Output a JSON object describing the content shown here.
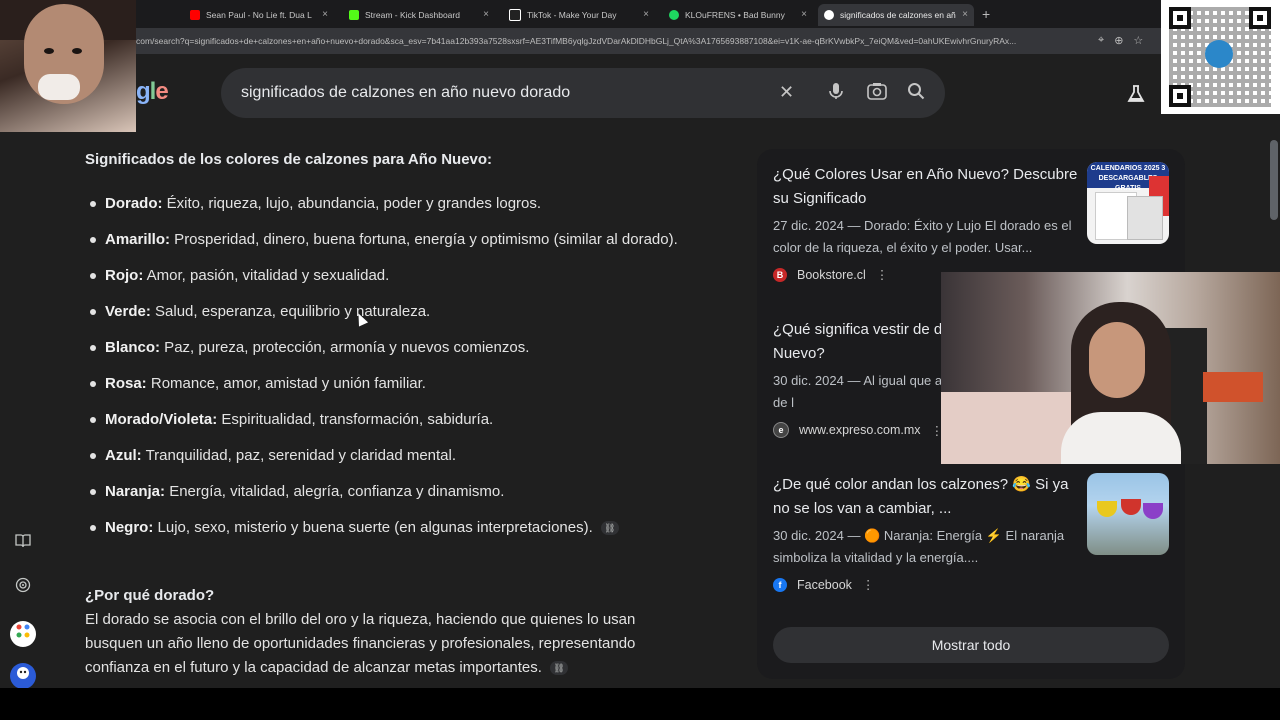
{
  "tabs": [
    {
      "label": "Sean Paul - No Lie ft. Dua L",
      "favicon_color": "#ff0000",
      "active": false
    },
    {
      "label": "Stream - Kick Dashboard",
      "favicon_color": "#53fc18",
      "active": false
    },
    {
      "label": "TikTok - Make Your Day",
      "favicon_color": "#ffffff",
      "active": false
    },
    {
      "label": "KLOuFRENS • Bad Bunny",
      "favicon_color": "#1ed760",
      "active": false
    },
    {
      "label": "significados de calzones en añ",
      "favicon_color": "#ffffff",
      "active": true
    }
  ],
  "tab_close": "×",
  "new_tab": "+",
  "url": "com/search?q=significados+de+calzones+en+año+nuevo+dorado&sca_esv=7b41aa12b393a7528sxsrf=AE3TifMB6yqlgJzdVDarAkDlDHbGLj_QtA%3A1765693887108&ei=v1K-ae-qBrKVwbkPx_7eiQM&ved=0ahUKEwivhrGnuryRAx...",
  "google": {
    "logo_text": "gle",
    "search_query": "significados de calzones en año nuevo dorado"
  },
  "main": {
    "heading": "Significados de los colores de calzones para Año Nuevo:",
    "items": [
      {
        "term": "Dorado:",
        "text": " Éxito, riqueza, lujo, abundancia, poder y grandes logros."
      },
      {
        "term": "Amarillo:",
        "text": " Prosperidad, dinero, buena fortuna, energía y optimismo (similar al dorado)."
      },
      {
        "term": "Rojo:",
        "text": " Amor, pasión, vitalidad y sexualidad."
      },
      {
        "term": "Verde:",
        "text": " Salud, esperanza, equilibrio y naturaleza."
      },
      {
        "term": "Blanco:",
        "text": " Paz, pureza, protección, armonía y nuevos comienzos."
      },
      {
        "term": "Rosa:",
        "text": " Romance, amor, amistad y unión familiar."
      },
      {
        "term": "Morado/Violeta:",
        "text": " Espiritualidad, transformación, sabiduría."
      },
      {
        "term": "Azul:",
        "text": " Tranquilidad, paz, serenidad y claridad mental."
      },
      {
        "term": "Naranja:",
        "text": " Energía, vitalidad, alegría, confianza y dinamismo."
      },
      {
        "term": "Negro:",
        "text": " Lujo, sexo, misterio y buena suerte (en algunas interpretaciones)."
      }
    ],
    "why_heading": "¿Por qué dorado?",
    "why_text": "El dorado se asocia con el brillo del oro y la riqueza, haciendo que quienes lo usan busquen un año lleno de oportunidades financieras y profesionales, representando confianza en el futuro y la capacidad de alcanzar metas importantes."
  },
  "sources": [
    {
      "title": "¿Qué Colores Usar en Año Nuevo? Descubre su Significado",
      "snippet": "27 dic. 2024 — Dorado: Éxito y Lujo El dorado es el color de la riqueza, el éxito y el poder. Usar...",
      "site": "Bookstore.cl",
      "site_icon_letter": "B",
      "site_icon_color": "#c62828",
      "thumb_text": "CALENDARIOS 2025 3 DESCARGABLES GRATIS"
    },
    {
      "title": "¿Qué significa vestir de dorado en Año Nuevo?",
      "snippet": "30 dic. 2024 — Al igual que amarillo, el rojo es uno de l",
      "site": "www.expreso.com.mx",
      "site_icon_letter": "e",
      "site_icon_color": "#444444"
    },
    {
      "title": "¿De qué color andan los calzones? 😂 Si ya no se los van a cambiar, ...",
      "snippet": "30 dic. 2024 — 🟠 Naranja: Energía ⚡ El naranja simboliza la vitalidad y la energía....",
      "site": "Facebook",
      "site_icon_letter": "f",
      "site_icon_color": "#1877f2"
    }
  ],
  "show_all": "Mostrar todo",
  "icons": {
    "more": "⋮",
    "clear": "✕",
    "mic": "🎙",
    "lens": "⌾",
    "search": "⌕",
    "labs": "⚗",
    "link": "🔗",
    "rail1": "📖",
    "rail2": "◎",
    "rail3": "✣",
    "rail4": "☻"
  }
}
